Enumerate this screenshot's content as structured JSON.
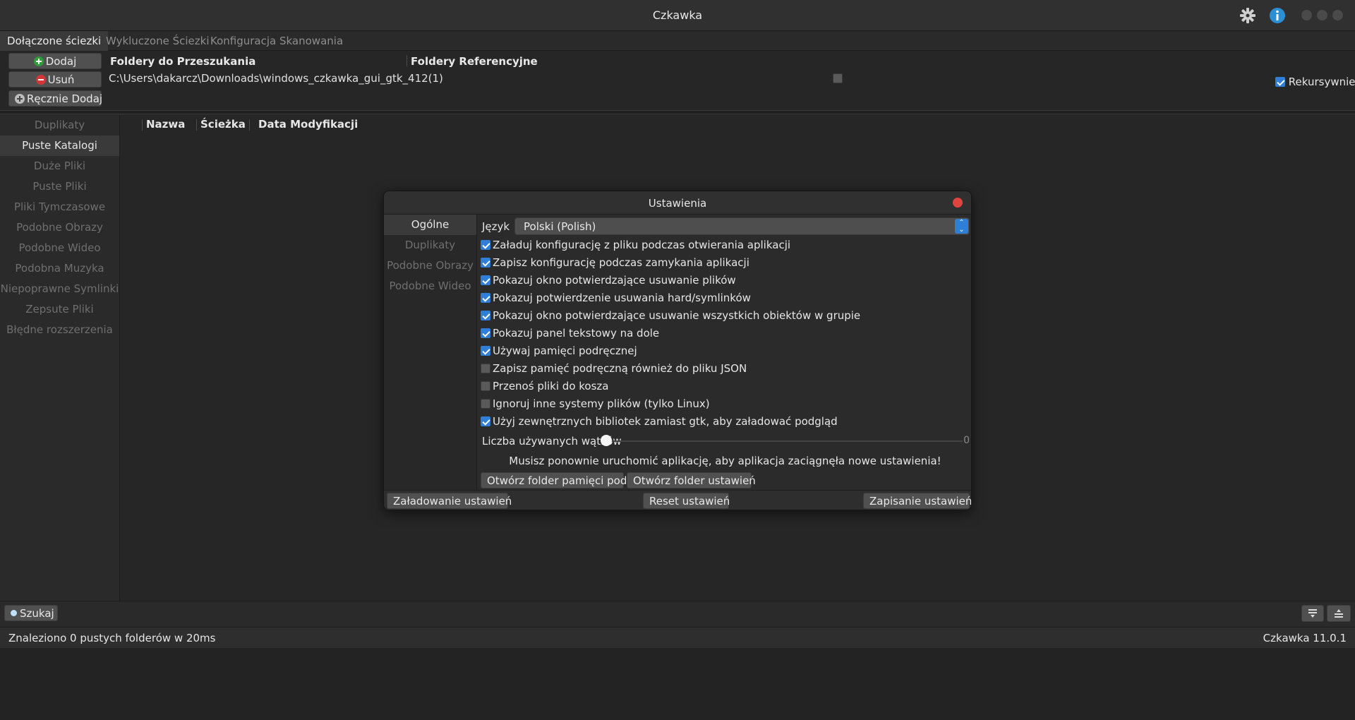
{
  "window": {
    "title": "Czkawka",
    "icons": {
      "settings": "gear-icon",
      "about": "info-icon"
    }
  },
  "tabs": [
    {
      "label": "Dołączone ściezki",
      "active": true
    },
    {
      "label": "Wykluczone Ściezki",
      "active": false
    },
    {
      "label": "Konfiguracja Skanowania",
      "active": false
    }
  ],
  "paths": {
    "add_label": "Dodaj",
    "remove_label": "Usuń",
    "manual_add_label": "Ręcznie Dodaj",
    "col_search": "Foldery do Przeszukania",
    "col_reference": "Foldery Referencyjne",
    "rows": [
      {
        "path": "C:\\Users\\dakarcz\\Downloads\\windows_czkawka_gui_gtk_412(1)",
        "reference": false
      }
    ],
    "recursive_label": "Rekursywnie",
    "recursive": true
  },
  "sidebar": {
    "items": [
      {
        "label": "Duplikaty",
        "active": false
      },
      {
        "label": "Puste Katalogi",
        "active": true
      },
      {
        "label": "Duże Pliki",
        "active": false
      },
      {
        "label": "Puste Pliki",
        "active": false
      },
      {
        "label": "Pliki Tymczasowe",
        "active": false
      },
      {
        "label": "Podobne Obrazy",
        "active": false
      },
      {
        "label": "Podobne Wideo",
        "active": false
      },
      {
        "label": "Podobna Muzyka",
        "active": false
      },
      {
        "label": "Niepoprawne Symlinki",
        "active": false
      },
      {
        "label": "Zepsute Pliki",
        "active": false
      },
      {
        "label": "Błędne rozszerzenia",
        "active": false
      }
    ]
  },
  "results": {
    "columns": [
      "Nazwa",
      "Ścieżka",
      "Data Modyfikacji"
    ]
  },
  "bottom": {
    "search_label": "Szukaj",
    "status_text": "Znaleziono 0 pustych folderów w 20ms",
    "version": "Czkawka 11.0.1"
  },
  "settings": {
    "title": "Ustawienia",
    "tabs": [
      {
        "label": "Ogólne",
        "active": true
      },
      {
        "label": "Duplikaty",
        "active": false
      },
      {
        "label": "Podobne Obrazy",
        "active": false
      },
      {
        "label": "Podobne Wideo",
        "active": false
      }
    ],
    "language_label": "Język",
    "language_value": "Polski (Polish)",
    "options": [
      {
        "label": "Załaduj konfigurację z pliku podczas otwierania aplikacji",
        "checked": true
      },
      {
        "label": "Zapisz konfigurację podczas zamykania aplikacji",
        "checked": true
      },
      {
        "label": "Pokazuj okno potwierdzające usuwanie plików",
        "checked": true
      },
      {
        "label": "Pokazuj potwierdzenie usuwania hard/symlinków",
        "checked": true
      },
      {
        "label": "Pokazuj okno potwierdzające usuwanie wszystkich obiektów w grupie",
        "checked": true
      },
      {
        "label": "Pokazuj panel tekstowy na dole",
        "checked": true
      },
      {
        "label": "Używaj pamięci podręcznej",
        "checked": true
      },
      {
        "label": "Zapisz pamięć podręczną również do pliku JSON",
        "checked": false
      },
      {
        "label": "Przenoś pliki do kosza",
        "checked": false
      },
      {
        "label": "Ignoruj inne systemy plików (tylko Linux)",
        "checked": false
      },
      {
        "label": "Użyj zewnętrznych bibliotek zamiast gtk, aby załadować podgląd",
        "checked": true
      }
    ],
    "threads_label": "Liczba używanych wątków",
    "threads_value": "0",
    "threads_fraction": 0,
    "restart_note": "Musisz ponownie uruchomić aplikację, aby aplikacja zaciągnęła nowe ustawienia!",
    "open_cache_label": "Otwórz folder pamięci podręcznej",
    "open_settings_label": "Otwórz folder ustawień",
    "load_label": "Załadowanie ustawień",
    "reset_label": "Reset ustawień",
    "save_label": "Zapisanie ustawień"
  }
}
